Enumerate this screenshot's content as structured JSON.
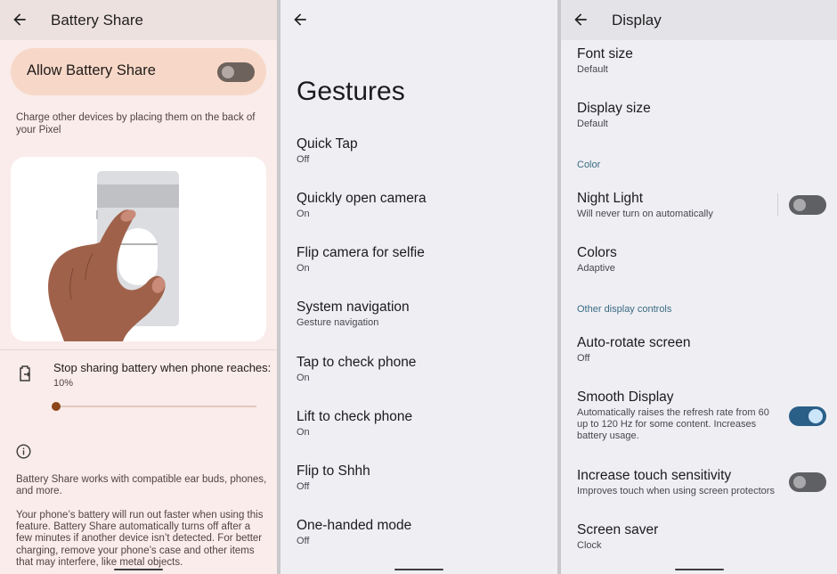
{
  "battery_share": {
    "title": "Battery Share",
    "allow_label": "Allow Battery Share",
    "allow_enabled": false,
    "description": "Charge other devices by placing them on the back of your Pixel",
    "stop_label": "Stop sharing battery when phone reaches:",
    "stop_value": "10%",
    "slider_fraction": 0.0,
    "body_1": "Battery Share works with compatible ear buds, phones, and more.",
    "body_2": "Your phone’s battery will run out faster when using this feature. Battery Share automatically turns off after a few minutes if another device isn’t detected. For better charging, remove your phone’s case and other items that may interfere, like metal objects.",
    "colors": {
      "accent": "#8b4518",
      "card": "#f7d8c8",
      "background": "#f9ecea"
    }
  },
  "gestures": {
    "title": "Gestures",
    "items": [
      {
        "title": "Quick Tap",
        "subtitle": "Off"
      },
      {
        "title": "Quickly open camera",
        "subtitle": "On"
      },
      {
        "title": "Flip camera for selfie",
        "subtitle": "On"
      },
      {
        "title": "System navigation",
        "subtitle": "Gesture navigation"
      },
      {
        "title": "Tap to check phone",
        "subtitle": "On"
      },
      {
        "title": "Lift to check phone",
        "subtitle": "On"
      },
      {
        "title": "Flip to Shhh",
        "subtitle": "Off"
      },
      {
        "title": "One-handed mode",
        "subtitle": "Off"
      }
    ]
  },
  "display": {
    "title": "Display",
    "items": [
      {
        "title": "Font size",
        "subtitle": "Default"
      },
      {
        "title": "Display size",
        "subtitle": "Default"
      }
    ],
    "section_color": "Color",
    "night_light": {
      "title": "Night Light",
      "subtitle": "Will never turn on automatically",
      "enabled": false
    },
    "colors": {
      "title": "Colors",
      "subtitle": "Adaptive"
    },
    "section_other": "Other display controls",
    "auto_rotate": {
      "title": "Auto-rotate screen",
      "subtitle": "Off"
    },
    "smooth_display": {
      "title": "Smooth Display",
      "subtitle": "Automatically raises the refresh rate from 60 up to 120 Hz for some content. Increases battery usage.",
      "enabled": true
    },
    "touch_sensitivity": {
      "title": "Increase touch sensitivity",
      "subtitle": "Improves touch when using screen protectors",
      "enabled": false
    },
    "screen_saver": {
      "title": "Screen saver",
      "subtitle": "Clock"
    },
    "colors_theme": {
      "accent": "#2a5f88",
      "section": "#3a6a85"
    }
  }
}
